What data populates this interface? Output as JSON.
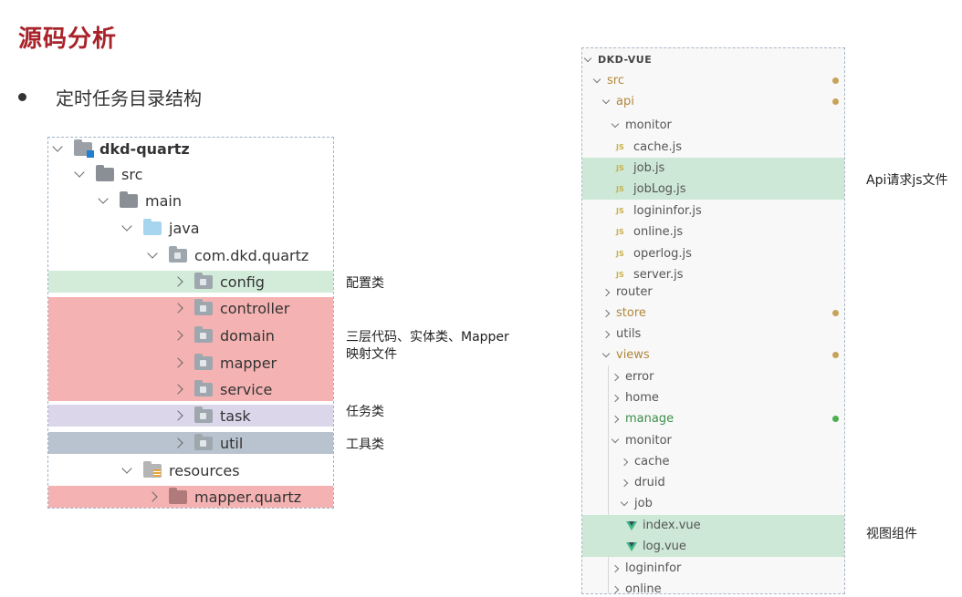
{
  "slide": {
    "title": "源码分析",
    "bullet": "定时任务目录结构"
  },
  "left_tree": {
    "rows": [
      {
        "label": "dkd-quartz"
      },
      {
        "label": "src"
      },
      {
        "label": "main"
      },
      {
        "label": "java"
      },
      {
        "label": "com.dkd.quartz"
      },
      {
        "label": "config"
      },
      {
        "label": "controller"
      },
      {
        "label": "domain"
      },
      {
        "label": "mapper"
      },
      {
        "label": "service"
      },
      {
        "label": "task"
      },
      {
        "label": "util"
      },
      {
        "label": "resources"
      },
      {
        "label": "mapper.quartz"
      }
    ],
    "highlight_colors": {
      "green": "#d3ecda",
      "red": "#f5b2b2",
      "purple": "#dcd6ea",
      "gray": "#b9c3cf"
    }
  },
  "annotations": {
    "config": "配置类",
    "layers_line1": "三层代码、实体类、Mapper",
    "layers_line2": "映射文件",
    "task": "任务类",
    "util": "工具类",
    "api": "Api请求js文件",
    "views": "视图组件"
  },
  "explorer": {
    "title": "DKD-VUE",
    "rows": [
      {
        "label": "src"
      },
      {
        "label": "api"
      },
      {
        "label": "monitor"
      },
      {
        "label": "cache.js"
      },
      {
        "label": "job.js"
      },
      {
        "label": "jobLog.js"
      },
      {
        "label": "logininfor.js"
      },
      {
        "label": "online.js"
      },
      {
        "label": "operlog.js"
      },
      {
        "label": "server.js"
      },
      {
        "label": "router"
      },
      {
        "label": "store"
      },
      {
        "label": "utils"
      },
      {
        "label": "views"
      },
      {
        "label": "error"
      },
      {
        "label": "home"
      },
      {
        "label": "manage"
      },
      {
        "label": "monitor"
      },
      {
        "label": "cache"
      },
      {
        "label": "druid"
      },
      {
        "label": "job"
      },
      {
        "label": "index.vue"
      },
      {
        "label": "log.vue"
      },
      {
        "label": "logininfor"
      },
      {
        "label": "online"
      }
    ],
    "js_badge": "JS",
    "colors": {
      "highlight": "#cde8d6",
      "modified": "#c7a35a",
      "added": "#4caf50"
    }
  }
}
